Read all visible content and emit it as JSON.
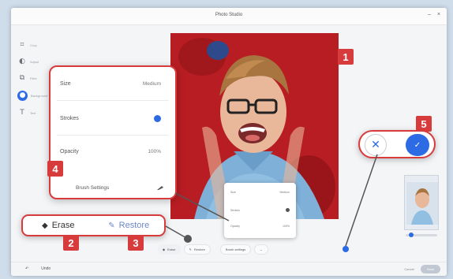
{
  "window": {
    "title": "Photo Studio",
    "controls": [
      "–",
      "×"
    ]
  },
  "sidebar": {
    "items": [
      {
        "icon": "crop-icon",
        "glyph": "⌗",
        "label": "Crop"
      },
      {
        "icon": "adjust-icon",
        "glyph": "◐",
        "label": "Adjust"
      },
      {
        "icon": "filter-icon",
        "glyph": "⧉",
        "label": "Filter"
      },
      {
        "icon": "background-icon",
        "glyph": "●",
        "label": "Background",
        "active": true
      },
      {
        "icon": "text-icon",
        "glyph": "T",
        "label": "Text"
      }
    ]
  },
  "brush_settings": {
    "size_label": "Size",
    "size_value": "Medium",
    "strokes_label": "Strokes",
    "opacity_label": "Opacity",
    "opacity_value": "100%",
    "button_label": "Brush Settings"
  },
  "mini_popup": {
    "size_label": "Size",
    "size_value": "Medium",
    "strokes_label": "Strokes",
    "opacity_label": "Opacity",
    "opacity_value": "100%"
  },
  "toolbar": {
    "erase_label": "Erase",
    "restore_label": "Restore",
    "brush_label": "Brush settings"
  },
  "edit_mode": {
    "erase_label": "Erase",
    "restore_label": "Restore"
  },
  "actions": {
    "cancel_glyph": "✕",
    "confirm_glyph": "✓"
  },
  "footer": {
    "left_items": [
      "↶",
      "Undo"
    ],
    "cancel_label": "Cancel",
    "save_label": "Save"
  },
  "callouts": [
    "1",
    "2",
    "3",
    "4",
    "5"
  ],
  "colors": {
    "accent": "#2d6be4",
    "callout": "#d83b3b",
    "photo_bg": "#b51c22"
  }
}
